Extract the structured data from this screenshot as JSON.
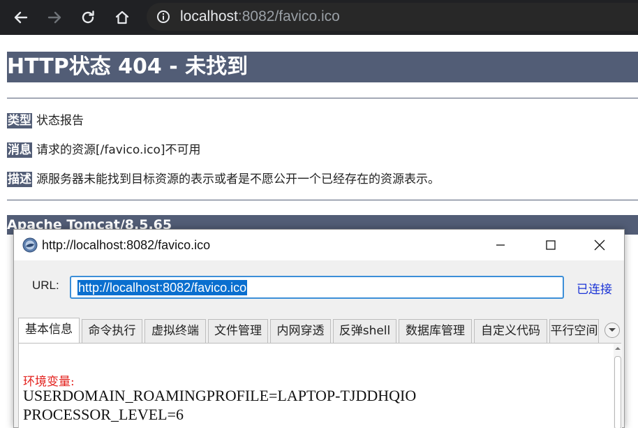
{
  "browser": {
    "url_host": "localhost",
    "url_rest": ":8082/favico.ico"
  },
  "error_page": {
    "title": "HTTP状态 404 - 未找到",
    "type_label": "类型",
    "type_value": "状态报告",
    "message_label": "消息",
    "message_value": "请求的资源[/favico.ico]不可用",
    "description_label": "描述",
    "description_value": "源服务器未能找到目标资源的表示或者是不愿公开一个已经存在的资源表示。",
    "footer": "Apache Tomcat/8.5.65"
  },
  "app_window": {
    "title": "http://localhost:8082/favico.ico",
    "url_label": "URL:",
    "url_value": "http://localhost:8082/favico.ico",
    "status": "已连接",
    "tabs": [
      "基本信息",
      "命令执行",
      "虚拟终端",
      "文件管理",
      "内网穿透",
      "反弹shell",
      "数据库管理",
      "自定义代码",
      "平行空间"
    ],
    "active_tab": "基本信息",
    "env_heading": "环境变量:",
    "env_lines": [
      "USERDOMAIN_ROAMINGPROFILE=LAPTOP-TJDDHQIO",
      "PROCESSOR_LEVEL=6"
    ]
  }
}
